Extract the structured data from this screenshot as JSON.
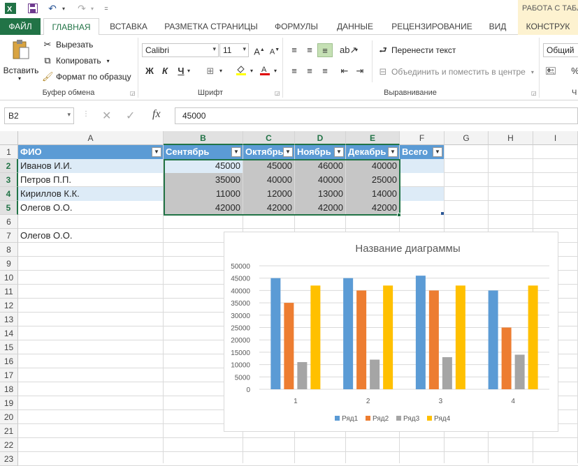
{
  "title_bar": {
    "app_icon": "excel-icon",
    "save_icon": "save-icon",
    "undo_icon": "undo-icon",
    "redo_icon": "redo-icon",
    "context_header": "РАБОТА С ТАБЛ"
  },
  "ribbon_tabs": {
    "file": "ФАЙЛ",
    "home": "ГЛАВНАЯ",
    "insert": "ВСТАВКА",
    "page_layout": "РАЗМЕТКА СТРАНИЦЫ",
    "formulas": "ФОРМУЛЫ",
    "data": "ДАННЫЕ",
    "review": "РЕЦЕНЗИРОВАНИЕ",
    "view": "ВИД",
    "design": "КОНСТРУК"
  },
  "clipboard": {
    "paste": "Вставить",
    "cut": "Вырезать",
    "copy": "Копировать",
    "format_painter": "Формат по образцу",
    "group_label": "Буфер обмена"
  },
  "font": {
    "name": "Calibri",
    "size": "11",
    "bold": "Ж",
    "italic": "К",
    "underline": "Ч",
    "group_label": "Шрифт"
  },
  "alignment": {
    "wrap_text": "Перенести текст",
    "merge_center": "Объединить и поместить в центре",
    "group_label": "Выравнивание"
  },
  "number": {
    "format": "Общий"
  },
  "formula_bar": {
    "name_box": "B2",
    "fx_label": "fx",
    "value": "45000"
  },
  "sheet": {
    "columns": [
      "A",
      "B",
      "C",
      "D",
      "E",
      "F",
      "G",
      "H",
      "I"
    ],
    "rows": [
      "1",
      "2",
      "3",
      "4",
      "5",
      "6",
      "7",
      "8",
      "9",
      "10",
      "11",
      "12",
      "13",
      "14",
      "15",
      "16",
      "17",
      "18",
      "19",
      "20",
      "21",
      "22",
      "23"
    ],
    "table_headers": [
      "ФИО",
      "Сентябрь",
      "Октябрь",
      "Ноябрь",
      "Декабрь",
      "Всего"
    ],
    "table_rows": [
      {
        "name": "Иванов И.И.",
        "values": [
          "45000",
          "45000",
          "46000",
          "40000"
        ]
      },
      {
        "name": "Петров П.П.",
        "values": [
          "35000",
          "40000",
          "40000",
          "25000"
        ]
      },
      {
        "name": "Кириллов К.К.",
        "values": [
          "11000",
          "12000",
          "13000",
          "14000"
        ]
      },
      {
        "name": "Олегов    О.О.",
        "values": [
          "42000",
          "42000",
          "42000",
          "42000"
        ]
      }
    ],
    "a7": "Олегов О.О."
  },
  "colors": {
    "excel_green": "#217346",
    "table_header": "#5b9bd5",
    "table_band": "#ddebf7",
    "selection_gray": "#c6c6c6"
  },
  "chart_data": {
    "type": "bar",
    "title": "Название диаграммы",
    "categories": [
      "1",
      "2",
      "3",
      "4"
    ],
    "series": [
      {
        "name": "Ряд1",
        "color": "#5b9bd5",
        "values": [
          45000,
          45000,
          46000,
          40000
        ]
      },
      {
        "name": "Ряд2",
        "color": "#ed7d31",
        "values": [
          35000,
          40000,
          40000,
          25000
        ]
      },
      {
        "name": "Ряд3",
        "color": "#a5a5a5",
        "values": [
          11000,
          12000,
          13000,
          14000
        ]
      },
      {
        "name": "Ряд4",
        "color": "#ffc000",
        "values": [
          42000,
          42000,
          42000,
          42000
        ]
      }
    ],
    "ylim": [
      0,
      50000
    ],
    "yticks": [
      "0",
      "5000",
      "10000",
      "15000",
      "20000",
      "25000",
      "30000",
      "35000",
      "40000",
      "45000",
      "50000"
    ],
    "gridlines": true,
    "legend_position": "bottom"
  }
}
